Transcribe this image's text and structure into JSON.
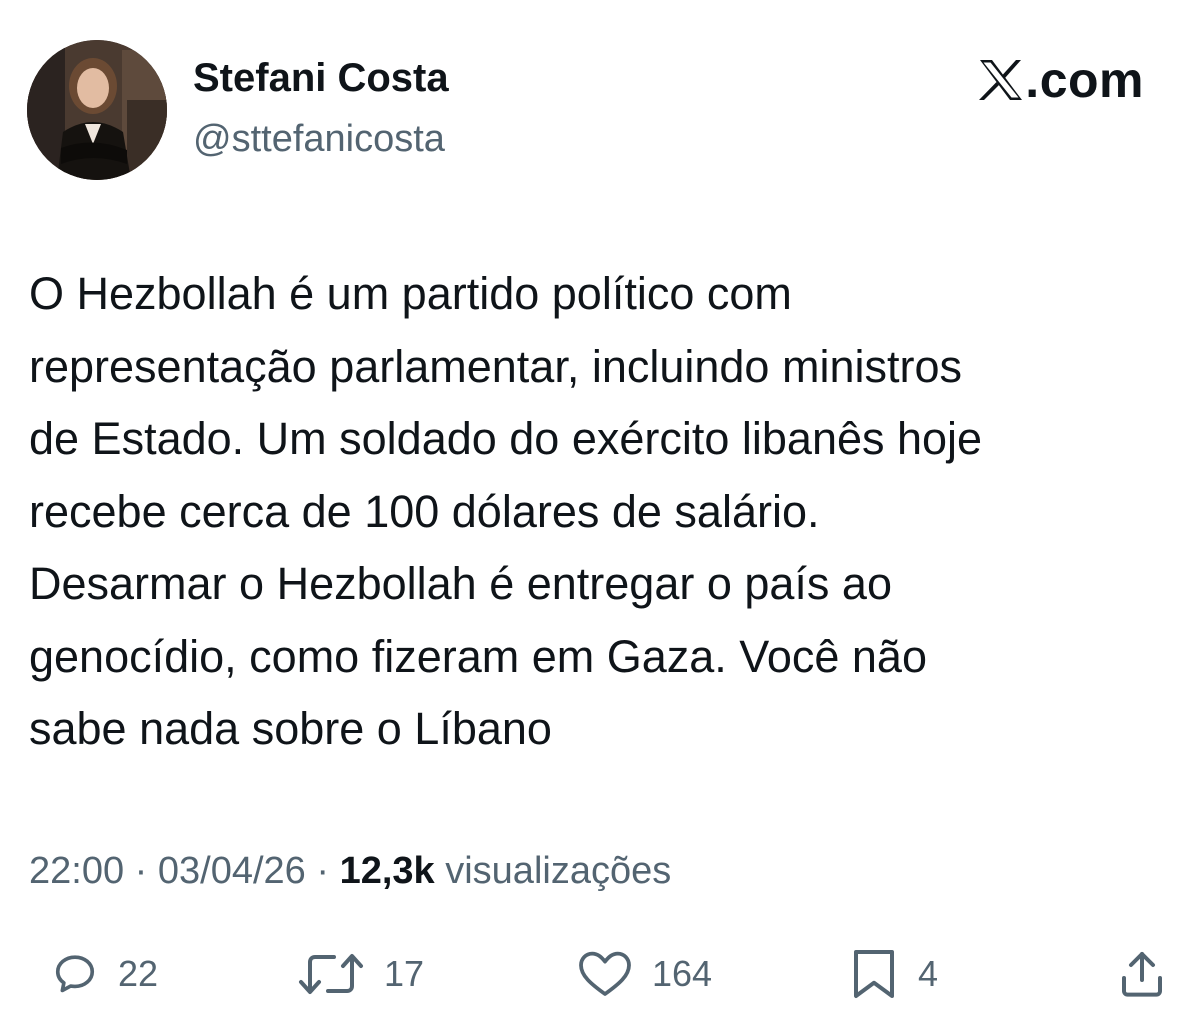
{
  "author": {
    "name": "Stefani Costa",
    "handle": "@sttefanicosta"
  },
  "brand": {
    "suffix": ".com",
    "icon": "x-logo-icon"
  },
  "tweet": {
    "text": "O Hezbollah é um partido político com\nrepresentação parlamentar, incluindo ministros\nde Estado. Um soldado do exército libanês hoje\nrecebe cerca de 100 dólares de salário.\nDesarmar o Hezbollah é entregar o país ao\ngenocídio, como fizeram em Gaza. Você não\nsabe nada sobre o Líbano",
    "time": "22:00",
    "separator": "·",
    "date": "03/04/26",
    "views_count": "12,3k",
    "views_label": "visualizações"
  },
  "actions": {
    "replies": {
      "icon": "reply-icon",
      "count": "22"
    },
    "reposts": {
      "icon": "repost-icon",
      "count": "17"
    },
    "likes": {
      "icon": "heart-icon",
      "count": "164"
    },
    "bookmarks": {
      "icon": "bookmark-icon",
      "count": "4"
    },
    "share": {
      "icon": "share-icon"
    }
  },
  "colors": {
    "text": "#0f1419",
    "secondary": "#536471",
    "background": "#ffffff"
  }
}
